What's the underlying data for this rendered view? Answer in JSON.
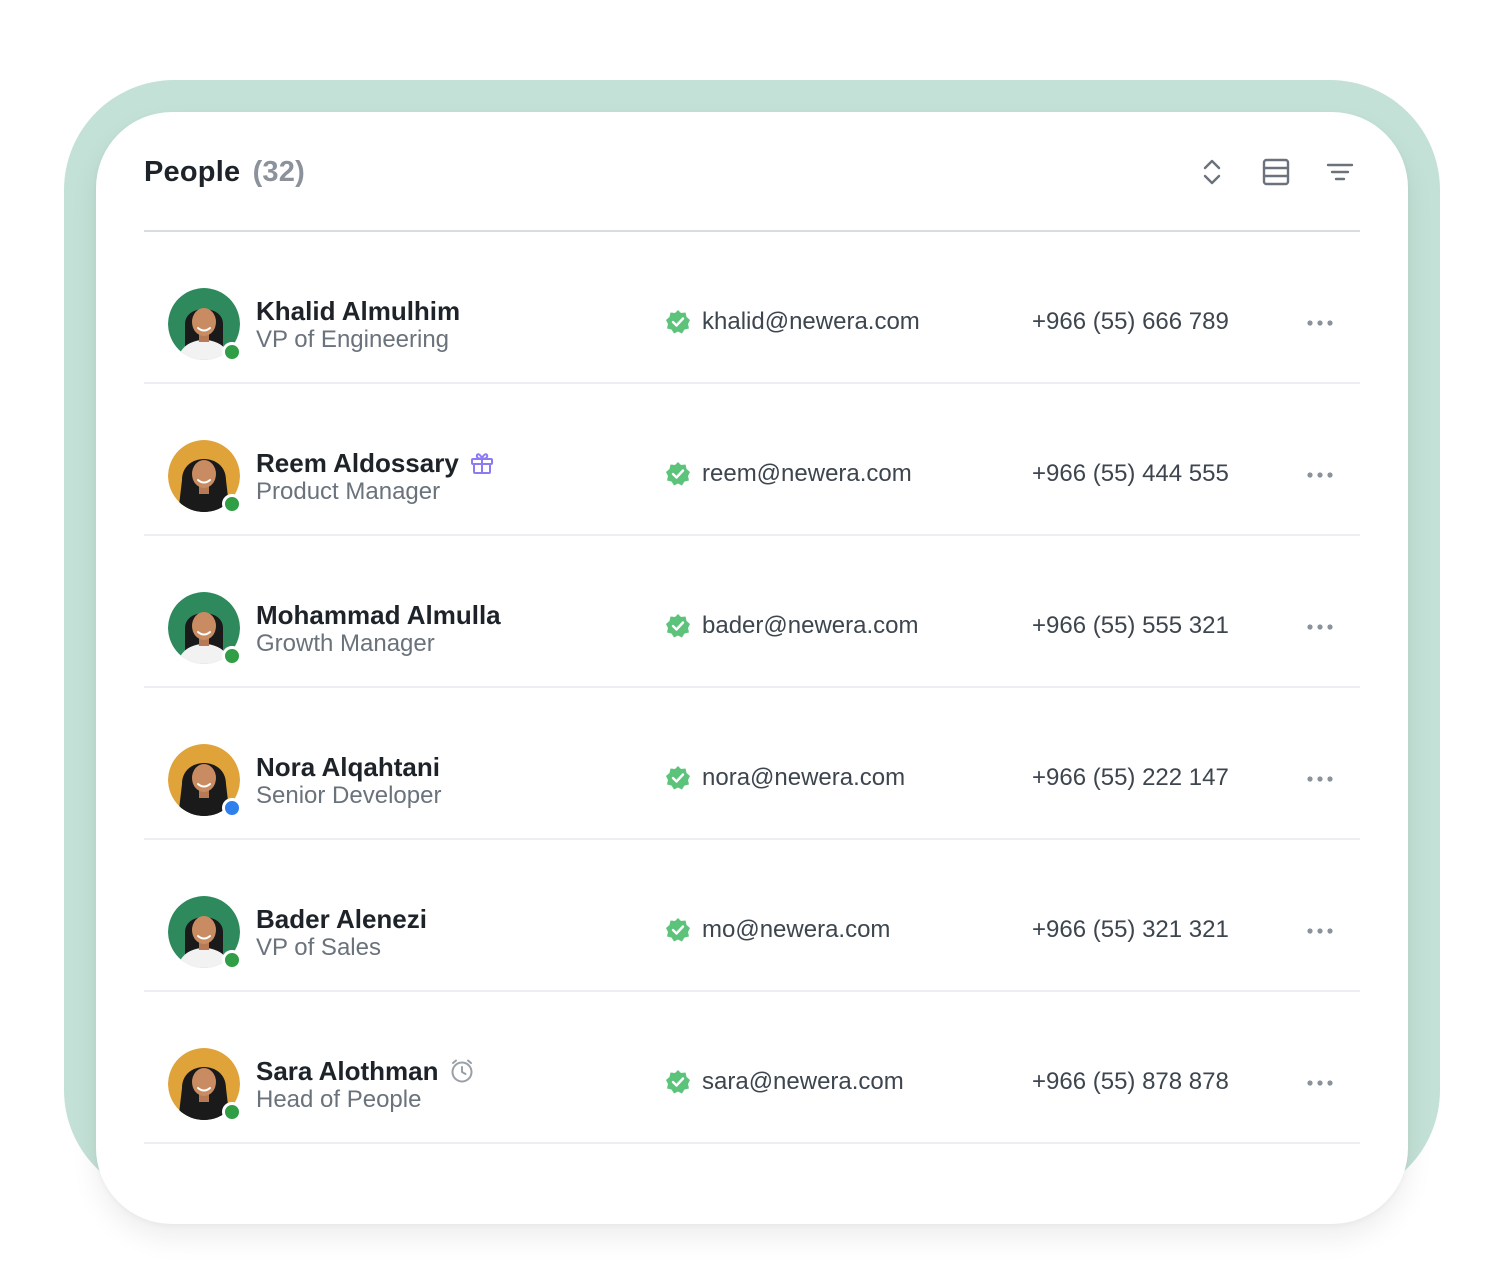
{
  "header": {
    "title": "People",
    "count": "(32)",
    "tools": [
      "sort-icon",
      "table-view-icon",
      "filter-icon"
    ]
  },
  "colors": {
    "frame": "#c3e1d6",
    "status_online": "#2f9e44",
    "status_away": "#2f80ed",
    "verified": "#5cc37a",
    "gift": "#8b7cf6",
    "clock": "#9aa0a8"
  },
  "people": [
    {
      "name": "Khalid Almulhim",
      "role": "VP of Engineering",
      "email": "khalid@newera.com",
      "phone": "+966 (55) 666 789",
      "status": "online",
      "avatar_bg": "#2e8a5d",
      "badge": null
    },
    {
      "name": "Reem Aldossary",
      "role": "Product Manager",
      "email": "reem@newera.com",
      "phone": "+966 (55) 444 555",
      "status": "online",
      "avatar_bg": "#e0a33a",
      "badge": "gift-icon"
    },
    {
      "name": "Mohammad Almulla",
      "role": "Growth Manager",
      "email": "bader@newera.com",
      "phone": "+966 (55) 555 321",
      "status": "online",
      "avatar_bg": "#2e8a5d",
      "badge": null
    },
    {
      "name": "Nora Alqahtani",
      "role": "Senior Developer",
      "email": "nora@newera.com",
      "phone": "+966 (55) 222 147",
      "status": "away",
      "avatar_bg": "#e0a33a",
      "badge": null
    },
    {
      "name": "Bader Alenezi",
      "role": "VP of Sales",
      "email": "mo@newera.com",
      "phone": "+966 (55) 321 321",
      "status": "online",
      "avatar_bg": "#2e8a5d",
      "badge": null
    },
    {
      "name": "Sara Alothman",
      "role": "Head of People",
      "email": "sara@newera.com",
      "phone": "+966 (55) 878 878",
      "status": "online",
      "avatar_bg": "#e0a33a",
      "badge": "clock-icon"
    }
  ]
}
